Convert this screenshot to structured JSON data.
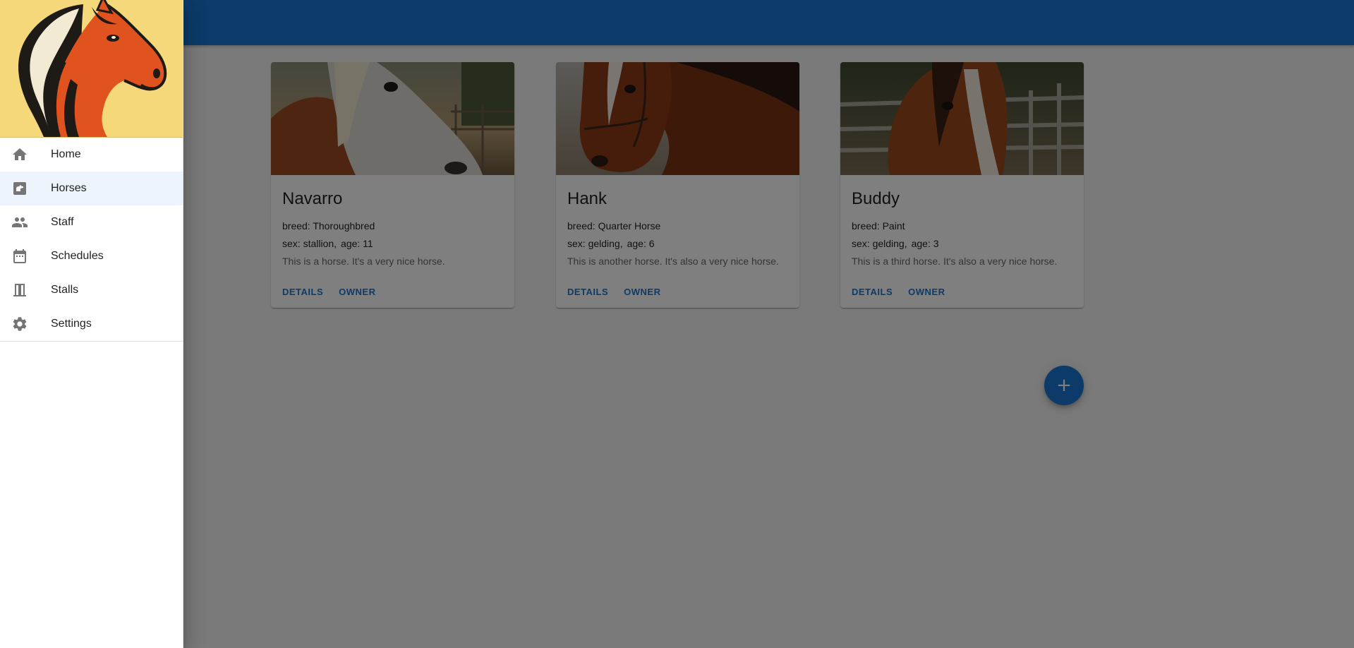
{
  "theme": {
    "primary": "#1976d2",
    "selected_bg": "#e8f0fb",
    "logo_bg": "#f4d87a",
    "horse_orange": "#e0531f"
  },
  "nav": {
    "items": [
      {
        "label": "Home",
        "icon": "home-icon"
      },
      {
        "label": "Horses",
        "icon": "horse-icon",
        "selected": true
      },
      {
        "label": "Staff",
        "icon": "people-icon"
      },
      {
        "label": "Schedules",
        "icon": "calendar-icon"
      },
      {
        "label": "Stalls",
        "icon": "stall-door-icon"
      },
      {
        "label": "Settings",
        "icon": "gear-icon"
      }
    ]
  },
  "horses": [
    {
      "name": "Navarro",
      "breed": "breed: Thoroughbred",
      "sex": "sex: stallion,",
      "age": "age: 11",
      "description": "This is a horse. It's a very nice horse.",
      "details_label": "DETAILS",
      "owner_label": "OWNER"
    },
    {
      "name": "Hank",
      "breed": "breed: Quarter Horse",
      "sex": "sex: gelding,",
      "age": "age: 6",
      "description": "This is another horse. It's also a very nice horse.",
      "details_label": "DETAILS",
      "owner_label": "OWNER"
    },
    {
      "name": "Buddy",
      "breed": "breed: Paint",
      "sex": "sex: gelding,",
      "age": "age: 3",
      "description": "This is a third horse. It's also a very nice horse.",
      "details_label": "DETAILS",
      "owner_label": "OWNER"
    }
  ],
  "fab": {
    "label": "+",
    "icon": "add-icon"
  }
}
